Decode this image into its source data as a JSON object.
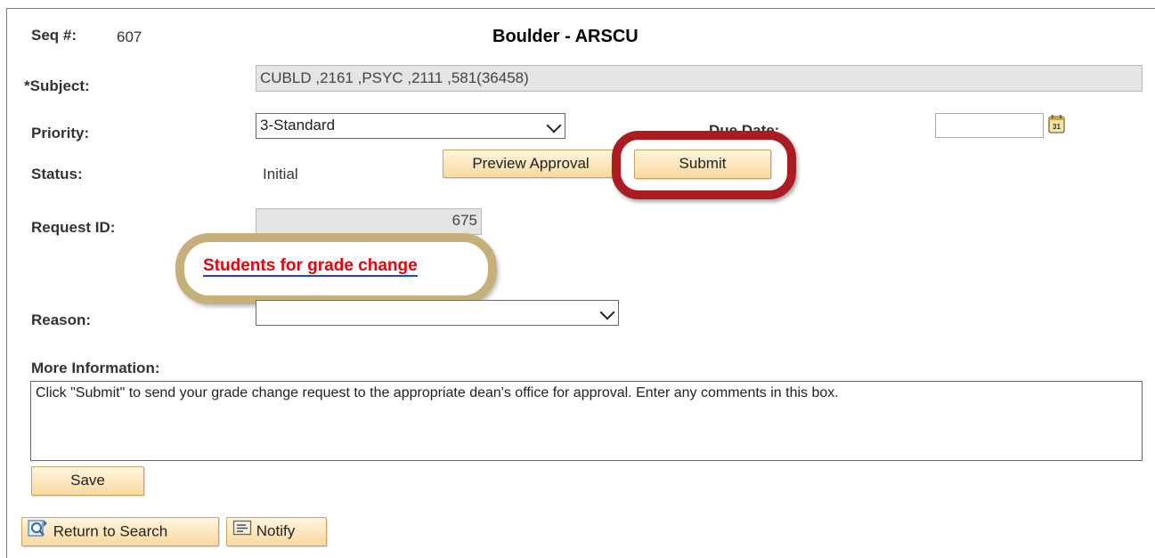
{
  "header": {
    "seq_label": "Seq #:",
    "seq_value": "607",
    "title": "Boulder - ARSCU"
  },
  "form": {
    "subject_label": "*Subject:",
    "subject_value": "CUBLD ,2161 ,PSYC ,2111 ,581(36458)",
    "priority_label": "Priority:",
    "priority_value": "3-Standard",
    "due_date_label": "Due Date:",
    "due_date_value": "",
    "status_label": "Status:",
    "status_value": "Initial",
    "request_id_label": "Request ID:",
    "request_id_value": "675",
    "reason_label": "Reason:",
    "reason_value": "",
    "more_info_label": "More Information:",
    "more_info_text": "Click \"Submit\" to send your grade change request to the appropriate dean's office for approval. Enter any comments in this box."
  },
  "buttons": {
    "preview_approval": "Preview Approval",
    "submit": "Submit",
    "save": "Save",
    "return_to_search": "Return to Search",
    "notify": "Notify"
  },
  "links": {
    "students_for_grade_change": "Students for grade change"
  },
  "colors": {
    "highlight_red": "#aa1c22",
    "highlight_gold": "#c4b078",
    "link_red": "#e8000b",
    "button_fill": "#f8d9a0"
  },
  "icons": {
    "calendar": "calendar-icon",
    "return_to_search": "search-magnifier-icon",
    "notify": "notify-icon",
    "dropdown": "chevron-down-icon"
  }
}
